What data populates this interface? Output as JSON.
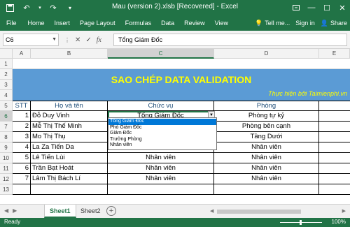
{
  "titlebar": {
    "title": "Mau (version 2).xlsb [Recovered] - Excel"
  },
  "ribbon": {
    "tabs": [
      "File",
      "Home",
      "Insert",
      "Page Layout",
      "Formulas",
      "Data",
      "Review",
      "View"
    ],
    "tell_me": "Tell me...",
    "sign_in": "Sign in",
    "share": "Share"
  },
  "formula_bar": {
    "name_box": "C6",
    "value": "Tổng Giám Đốc"
  },
  "columns": [
    "A",
    "B",
    "C",
    "D",
    "E"
  ],
  "rows": [
    "1",
    "2",
    "3",
    "4",
    "5",
    "6",
    "7",
    "8",
    "9",
    "10",
    "11",
    "12",
    "13"
  ],
  "sheet": {
    "banner_title": "SAO CHÉP DATA VALIDATION",
    "banner_sub": "Thực hiện bởi Taimienphi.vn",
    "headers": {
      "stt": "STT",
      "name": "Họ và tên",
      "position": "Chức vụ",
      "room": "Phòng"
    },
    "records": [
      {
        "stt": "1",
        "name": "Đỗ Duy Vinh",
        "position": "Tổng Giám Đốc",
        "room": "Phòng tự kỷ"
      },
      {
        "stt": "2",
        "name": "Mễ Thị Thế Minh",
        "position": "",
        "room": "Phòng bên cạnh"
      },
      {
        "stt": "3",
        "name": "Mo Thị Thụ",
        "position": "",
        "room": "Tầng Dưới"
      },
      {
        "stt": "4",
        "name": "La Za Tiến Da",
        "position": "",
        "room": "Nhân viên"
      },
      {
        "stt": "5",
        "name": "Lê Tiến Lùi",
        "position": "Nhân viên",
        "room": "Nhân viên"
      },
      {
        "stt": "6",
        "name": "Trần Bạt Hoát",
        "position": "Nhân viên",
        "room": "Nhân viên"
      },
      {
        "stt": "7",
        "name": "Lâm Thị Bách Lí",
        "position": "Nhân viên",
        "room": "Nhân viên"
      }
    ]
  },
  "dropdown": {
    "options": [
      "Tổng Giám Đốc",
      "Phó Giám Đốc",
      "Giám Đốc",
      "Trưởng Phòng",
      "Nhân viên"
    ]
  },
  "sheet_tabs": [
    "Sheet1",
    "Sheet2"
  ],
  "status": {
    "ready": "Ready",
    "zoom": "100%"
  },
  "colors": {
    "excel_green": "#217346",
    "banner_blue": "#5b9bd5",
    "banner_text": "#ffff00"
  }
}
